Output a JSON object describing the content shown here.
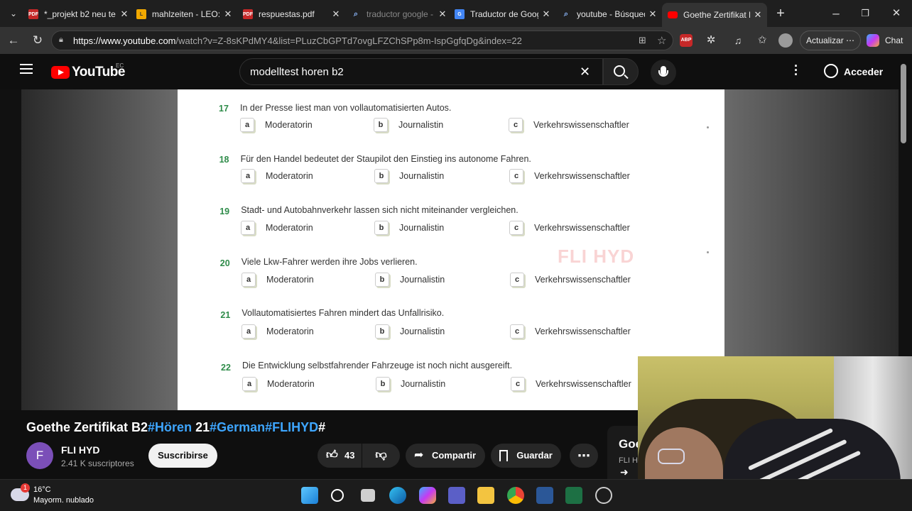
{
  "tabs": [
    {
      "title": "*_projekt b2 neu te",
      "icon": "pdf-icon",
      "color": "#c62828",
      "active": false
    },
    {
      "title": "mahlzeiten - LEO: T",
      "icon": "leo-icon",
      "color": "#f2a900",
      "active": false
    },
    {
      "title": "respuestas.pdf",
      "icon": "pdf-icon",
      "color": "#c62828",
      "active": false
    },
    {
      "title": "traductor google -",
      "icon": "search-icon",
      "color": "#4285f4",
      "active": false
    },
    {
      "title": "Traductor de Goog",
      "icon": "translate-icon",
      "color": "#4285f4",
      "active": false
    },
    {
      "title": "youtube - Búsqued",
      "icon": "search-icon",
      "color": "#4285f4",
      "active": false
    },
    {
      "title": "Goethe Zertifikat B",
      "icon": "youtube-icon",
      "color": "#ff0000",
      "active": true
    }
  ],
  "address": {
    "host": "https://www.youtube.com",
    "path": "/watch?v=Z-8sKPdMY4&list=PLuzCbGPTd7ovgLFZChSPp8m-IspGgfqDg&index=22"
  },
  "browser": {
    "update_label": "Actualizar",
    "chat_label": "Chat",
    "abp_label": "ABP"
  },
  "youtube": {
    "logo_text": "YouTube",
    "region": "EC",
    "search_value": "modelltest horen b2",
    "signin_label": "Acceder"
  },
  "document": {
    "questions": [
      {
        "num": "17",
        "text": "In der Presse liest man von vollautomatisierten Autos."
      },
      {
        "num": "18",
        "text": "Für den Handel bedeutet der Staupilot den Einstieg ins autonome Fahren."
      },
      {
        "num": "19",
        "text": "Stadt- und Autobahnverkehr lassen sich nicht miteinander vergleichen."
      },
      {
        "num": "20",
        "text": "Viele Lkw-Fahrer werden ihre Jobs verlieren."
      },
      {
        "num": "21",
        "text": "Vollautomatisiertes Fahren mindert das Unfallrisiko."
      },
      {
        "num": "22",
        "text": "Die Entwicklung selbstfahrender Fahrzeuge ist noch nicht ausgereift."
      }
    ],
    "options": [
      {
        "letter": "a",
        "label": "Moderatorin"
      },
      {
        "letter": "b",
        "label": "Journalistin"
      },
      {
        "letter": "c",
        "label": "Verkehrswissenschaftler"
      }
    ],
    "watermark": "FLI HYD"
  },
  "video": {
    "title_parts": [
      {
        "text": "Goethe Zertifikat B2",
        "tag": false
      },
      {
        "text": "#Hören",
        "tag": true
      },
      {
        "text": " 21",
        "tag": false
      },
      {
        "text": "#German",
        "tag": true
      },
      {
        "text": "#FLIHYD",
        "tag": true
      },
      {
        "text": "#",
        "tag": false
      }
    ],
    "channel_initial": "F",
    "channel": "FLI HYD",
    "subscribers": "2.41 K suscriptores",
    "subscribe_label": "Suscribirse",
    "likes": "43",
    "share_label": "Compartir",
    "save_label": "Guardar",
    "side_card_title": "Goe",
    "side_card_sub": "FLI H"
  },
  "taskbar": {
    "temperature": "16°C",
    "weather": "Mayorm. nublado",
    "badge": "1"
  }
}
